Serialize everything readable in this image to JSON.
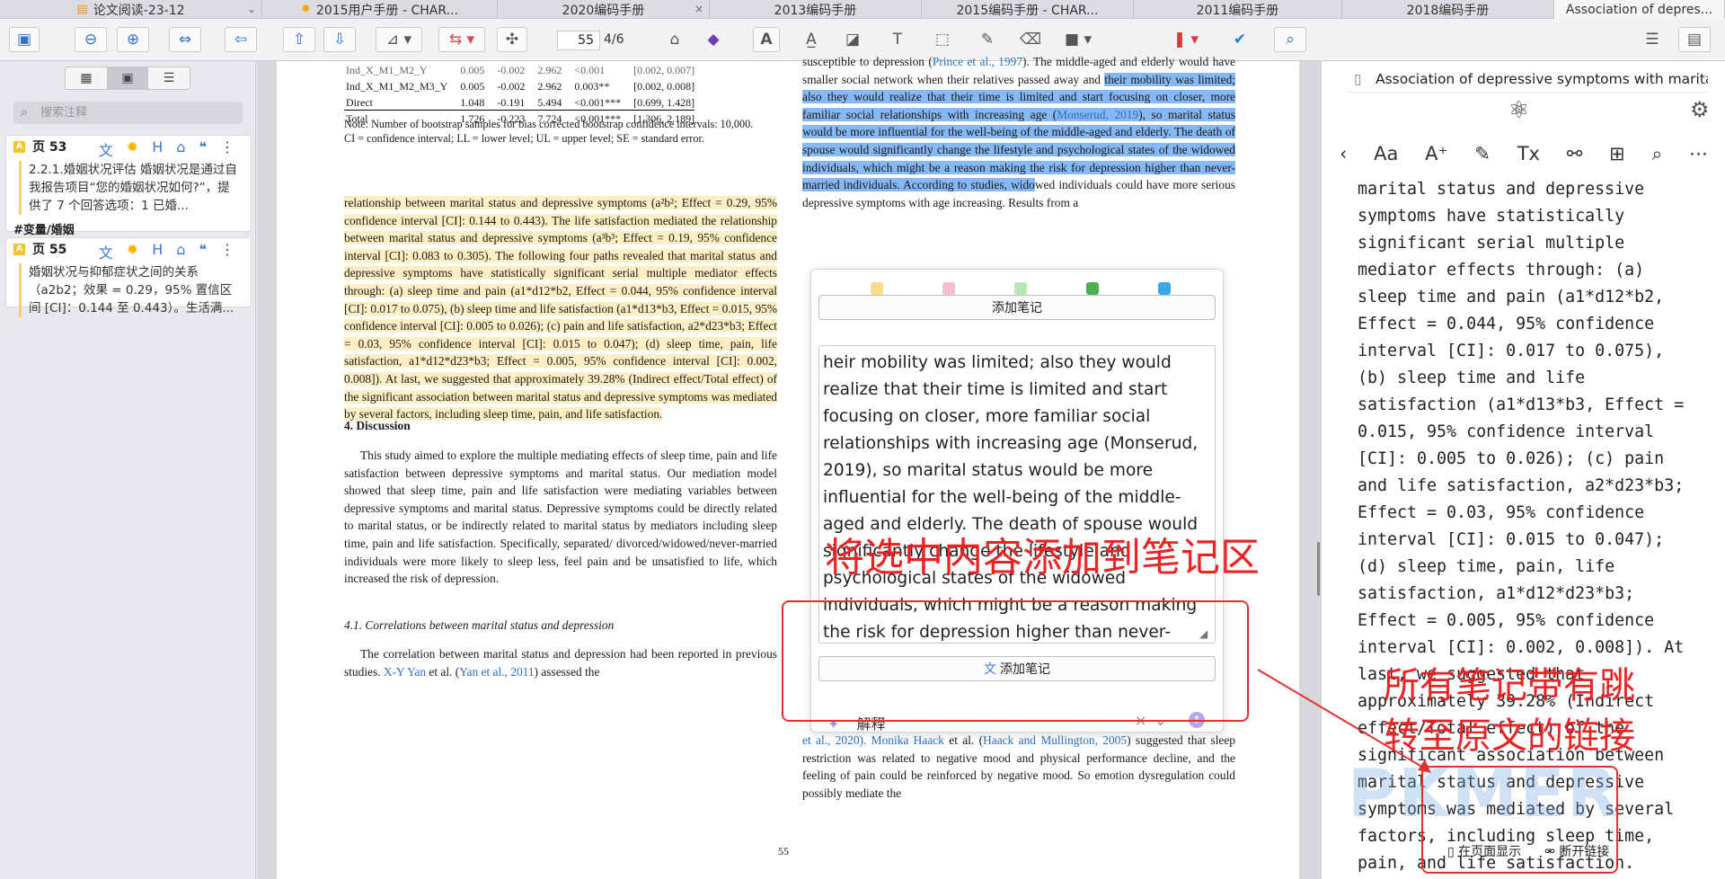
{
  "tabs": [
    {
      "label": "论文阅读-23-12",
      "active": false
    },
    {
      "label": "2015用户手册 - CHAR...",
      "active": false
    },
    {
      "label": "2020编码手册",
      "active": false
    },
    {
      "label": "2013编码手册",
      "active": false
    },
    {
      "label": "2015编码手册 - CHAR...",
      "active": false
    },
    {
      "label": "2011编码手册",
      "active": false
    },
    {
      "label": "2018编码手册",
      "active": false
    },
    {
      "label": "Association of depres...",
      "active": true
    }
  ],
  "toolbar": {
    "page_current": "55",
    "page_total": "4/6"
  },
  "sidebar": {
    "search_placeholder": "搜索注释",
    "cards": [
      {
        "page": "页 53",
        "text": "2.2.1.婚姻状况评估 婚姻状况是通过自我报告项目“您的婚姻状况如何?”，提供了 7 个回答选项：1 已婚...",
        "tag": "#变量/婚姻"
      },
      {
        "page": "页 55",
        "text": "婚姻状况与抑郁症状之间的关系 （a2b2；效果 = 0.29，95% 置信区间 [CI]：0.144 至 0.443）。生活满..."
      }
    ]
  },
  "doc": {
    "table_rows": [
      [
        "Ind_X_M1_M2_Y",
        "0.005",
        "-0.002",
        "2.962",
        "<0.001",
        "[0.002, 0.007]"
      ],
      [
        "Ind_X_M1_M2_M3_Y",
        "0.005",
        "-0.002",
        "2.962",
        "0.003**",
        "[0.002, 0.008]"
      ],
      [
        "Direct",
        "1.048",
        "-0.191",
        "5.494",
        "<0.001***",
        "[0.699, 1.428]"
      ],
      [
        "Total",
        "1.726",
        "-0.223",
        "7.724",
        "<0.001***",
        "[1.306, 2.189]"
      ]
    ],
    "note1": "Note: Number of bootstrap samples for bias corrected bootstrap confidence intervals: 10,000.",
    "note2": "CI = confidence interval; LL = lower level; UL = upper level; SE = standard error.",
    "para_highlight": "relationship between marital status and depressive symptoms (a²b²; Effect = 0.29, 95% confidence interval [CI]: 0.144 to 0.443). The life satisfaction mediated the relationship between marital status and depressive symptoms (a³b³; Effect = 0.19, 95% confidence interval [CI]: 0.083 to 0.305). The following four paths revealed that marital status and depressive symptoms have statistically significant serial multiple mediator effects through: (a) sleep time and pain (a1*d12*b2, Effect = 0.044, 95% confidence interval [CI]: 0.017 to 0.075), (b) sleep time and life satisfaction (a1*d13*b3, Effect = 0.015, 95% confidence interval [CI]: 0.005 to 0.026); (c) pain and life satisfaction, a2*d23*b3; Effect = 0.03, 95% confidence interval [CI]: 0.015 to 0.047); (d) sleep time, pain, life satisfaction, a1*d12*d23*b3; Effect = 0.005, 95% confidence interval [CI]: 0.002, 0.008]). At last, we suggested that approximately 39.28% (Indirect effect/Total effect) of the significant association between marital status and depressive symptoms was mediated by several factors, including sleep time, pain, and life satisfaction.",
    "section4": "4.  Discussion",
    "para_discussion": "This study aimed to explore the multiple mediating effects of sleep time, pain and life satisfaction between depressive symptoms and marital status. Our mediation model showed that sleep time, pain and life satisfaction were mediating variables between depressive symptoms and marital status. Depressive symptoms could be directly related to marital status, or be indirectly related to marital status by mediators including sleep time, pain and life satisfaction. Specifically, separated/ divorced/widowed/never-married individuals were more likely to sleep less, feel pain and be unsatisfied to life, which increased the risk of depression.",
    "section41": "4.1.  Correlations between marital status and depression",
    "para_corr_a": "The correlation between marital status and depression had been reported in previous studies. ",
    "para_corr_link1": "X-Y Yan",
    "para_corr_b": " et al. (",
    "para_corr_link2": "Yan et al., 2011",
    "para_corr_c": ") assessed the",
    "right_line0": "susceptible to depression (",
    "right_link0": "Prince et al., 1997",
    "right_line0b": "). The middle-aged and elderly would have smaller social network when their relatives passed away and ",
    "right_sel_a": "their mobility was limited; also they would realize that their time is limited and start focusing on closer, more familiar social relationships with increasing age (",
    "right_sel_link": "Monserud, 2019",
    "right_sel_b": "), so marital status would be more influential for the well-being of the middle-aged and elderly. The death of spouse would significantly change the lifestyle and psychological states of the widowed individuals, which might be a reason making the risk for depression higher than never-married individuals. According to studies, wido",
    "right_after": "wed individuals could have more serious depressive symptoms with age increasing. Results from a",
    "right_bottom_a": "et al., 2020). ",
    "right_bottom_link": "Monika Haack",
    "right_bottom_b": " et al. (",
    "right_bottom_link2": "Haack and Mullington, 2005",
    "right_bottom_c": ") suggested that sleep restriction was related to negative mood and physical performance decline, and the feeling of pain could be reinforced by negative mood. So emotion dysregulation could possibly mediate the",
    "page_number": "55"
  },
  "popup": {
    "colors": [
      "#f7dc8a",
      "#f4bcd0",
      "#b9e6b5",
      "#4caf50",
      "#3aa7e8"
    ],
    "add_note_top": "添加笔记",
    "text": "heir mobility was limited; also they would realize that their time is limited and start focusing on closer, more familiar social relationships with increasing age (Monserud, 2019), so marital status would be more influential for the well-being of the middle-aged and elderly. The death of spouse would significantly change the lifestyle and psychological states of the widowed individuals, which might be a reason making the risk for depression higher than never-married individuals. According to studies, wido",
    "add_note_bottom": "添加笔记",
    "explain": "解释"
  },
  "right_pane": {
    "title": "Association of depressive symptoms with marital status ...",
    "body": "marital status and depressive symptoms have statistically significant serial multiple mediator effects through: (a) sleep time and pain (a1*d12*b2, Effect = 0.044, 95% confidence interval [CI]: 0.017 to 0.075), (b) sleep time and life satisfaction (a1*d13*b3, Effect = 0.015, 95% confidence interval [CI]: 0.005 to 0.026); (c) pain and life satisfaction, a2*d23*b3; Effect = 0.03, 95% confidence interval [CI]: 0.015 to 0.047); (d) sleep time, pain, life satisfaction, a1*d12*d23*b3; Effect = 0.005, 95% confidence interval [CI]: 0.002, 0.008]). At last, we suggested that approximately 39.28% (Indirect effect/Total effect) of the significant association between marital status and depressive symptoms was mediated by several factors, including sleep time, pain, and life satisfaction.",
    "show_in_page": "在页面显示",
    "unlink": "断开链接"
  },
  "annotations": {
    "label1": "将选中内容添加到笔记区",
    "label2": "所有笔记带有跳",
    "label3": "转至原文的链接",
    "watermark": "PKMER"
  }
}
